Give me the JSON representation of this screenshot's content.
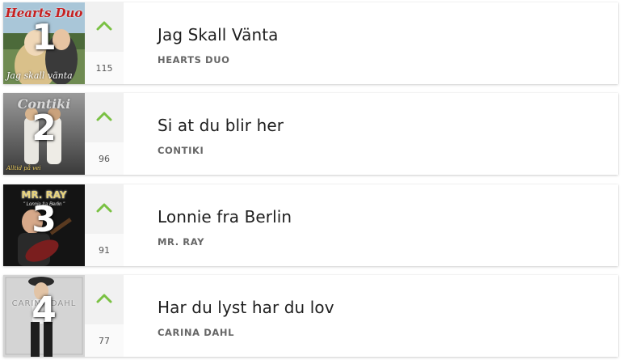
{
  "accent_color": "#7ac143",
  "entries": [
    {
      "rank": "1",
      "title": "Jag Skall Vänta",
      "artist": "HEARTS DUO",
      "votes": "115",
      "cover": {
        "brand": "Hearts Duo",
        "caption": "Jag skall vänta"
      }
    },
    {
      "rank": "2",
      "title": "Si at du blir her",
      "artist": "CONTIKI",
      "votes": "96",
      "cover": {
        "brand": "Contiki",
        "caption": "Alltid på vei"
      }
    },
    {
      "rank": "3",
      "title": "Lonnie fra Berlin",
      "artist": "MR. RAY",
      "votes": "91",
      "cover": {
        "brand": "MR. RAY",
        "subtitle": "\" Lonnie fra Berlin \""
      }
    },
    {
      "rank": "4",
      "title": "Har du lyst har du lov",
      "artist": "CARINA DAHL",
      "votes": "77",
      "cover": {
        "brand": "CARINA DAHL"
      }
    }
  ]
}
